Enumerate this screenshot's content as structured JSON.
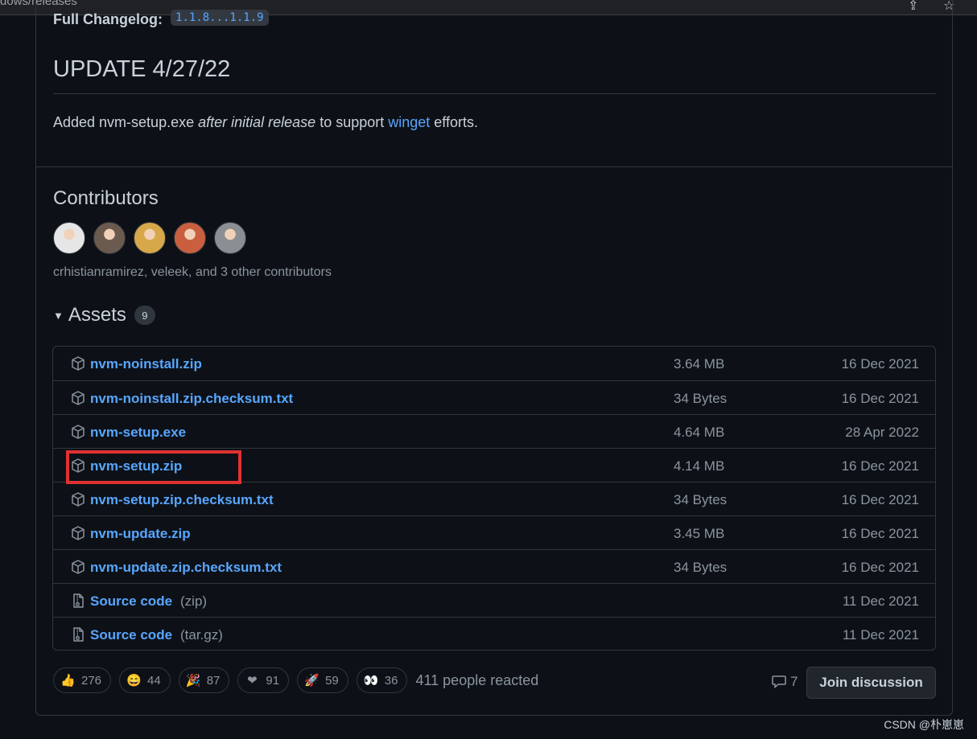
{
  "browser": {
    "url_fragment": "dows/releases"
  },
  "changelog": {
    "label": "Full Changelog:",
    "range": "1.1.8...1.1.9"
  },
  "update": {
    "title": "UPDATE 4/27/22",
    "text_before": "Added nvm-setup.exe ",
    "text_italic": "after initial release",
    "text_mid": " to support ",
    "link": "winget",
    "text_after": " efforts."
  },
  "contributors": {
    "title": "Contributors",
    "avatar_colors": [
      "#e6e6e6",
      "#6b5a4e",
      "#d6a84a",
      "#c95f3f",
      "#8a8f94"
    ],
    "summary": "crhistianramirez, veleek, and 3 other contributors"
  },
  "assets": {
    "title": "Assets",
    "count": "9",
    "items": [
      {
        "name": "nvm-noinstall.zip",
        "suffix": "",
        "size": "3.64 MB",
        "date": "16 Dec 2021",
        "icon": "package-icon"
      },
      {
        "name": "nvm-noinstall.zip.checksum.txt",
        "suffix": "",
        "size": "34 Bytes",
        "date": "16 Dec 2021",
        "icon": "package-icon"
      },
      {
        "name": "nvm-setup.exe",
        "suffix": "",
        "size": "4.64 MB",
        "date": "28 Apr 2022",
        "icon": "package-icon"
      },
      {
        "name": "nvm-setup.zip",
        "suffix": "",
        "size": "4.14 MB",
        "date": "16 Dec 2021",
        "icon": "package-icon"
      },
      {
        "name": "nvm-setup.zip.checksum.txt",
        "suffix": "",
        "size": "34 Bytes",
        "date": "16 Dec 2021",
        "icon": "package-icon"
      },
      {
        "name": "nvm-update.zip",
        "suffix": "",
        "size": "3.45 MB",
        "date": "16 Dec 2021",
        "icon": "package-icon"
      },
      {
        "name": "nvm-update.zip.checksum.txt",
        "suffix": "",
        "size": "34 Bytes",
        "date": "16 Dec 2021",
        "icon": "package-icon"
      },
      {
        "name": "Source code",
        "suffix": "(zip)",
        "size": "",
        "date": "11 Dec 2021",
        "icon": "file-zip-icon"
      },
      {
        "name": "Source code",
        "suffix": "(tar.gz)",
        "size": "",
        "date": "11 Dec 2021",
        "icon": "file-zip-icon"
      }
    ]
  },
  "reactions": {
    "items": [
      {
        "emoji": "👍",
        "count": "276",
        "icon": "thumbs-up-icon"
      },
      {
        "emoji": "😄",
        "count": "44",
        "icon": "smile-icon"
      },
      {
        "emoji": "🎉",
        "count": "87",
        "icon": "tada-icon"
      },
      {
        "emoji": "❤",
        "count": "91",
        "icon": "heart-icon"
      },
      {
        "emoji": "🚀",
        "count": "59",
        "icon": "rocket-icon"
      },
      {
        "emoji": "👀",
        "count": "36",
        "icon": "eyes-icon"
      }
    ],
    "summary": "411 people reacted"
  },
  "discussion": {
    "comment_count": "7",
    "join_label": "Join discussion"
  },
  "watermark": "CSDN @朴崽崽",
  "colors": {
    "link": "#58a6ff",
    "highlight": "#e03131",
    "background": "#0d1117"
  }
}
